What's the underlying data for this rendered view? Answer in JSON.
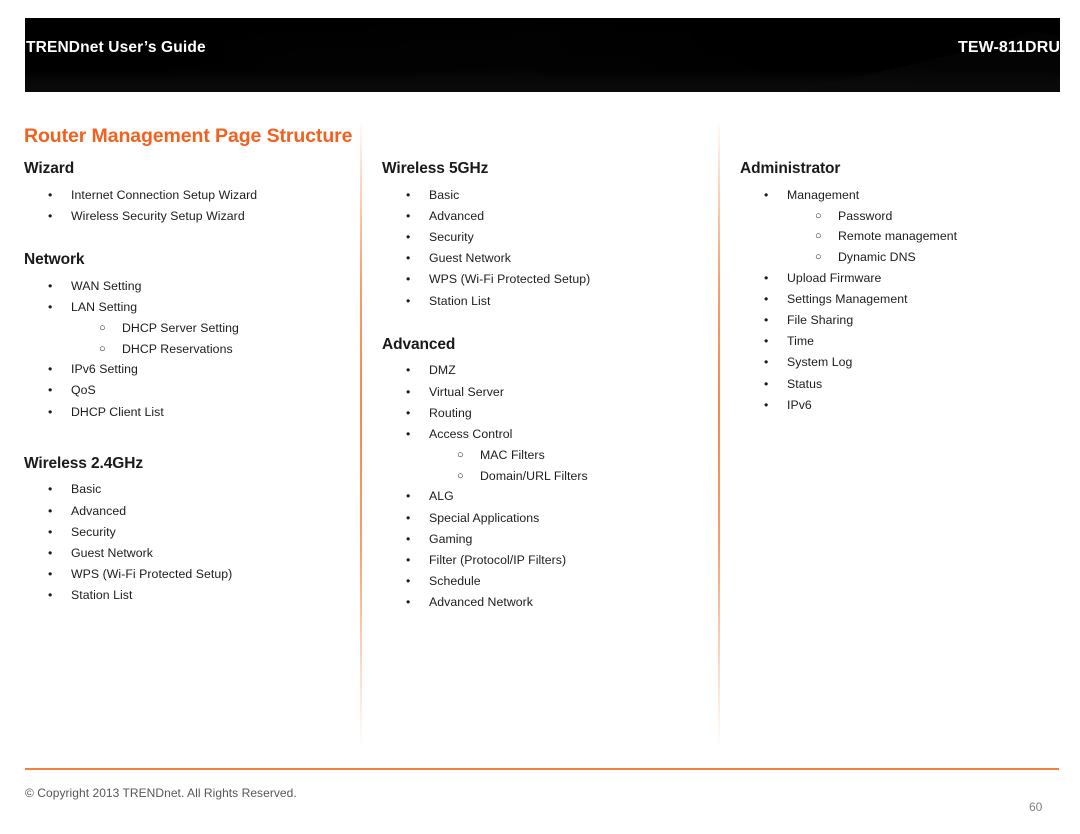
{
  "header": {
    "guide_title": "TRENDnet User’s Guide",
    "model": "TEW-811DRU"
  },
  "page_title": "Router Management Page Structure",
  "colors": {
    "accent_orange": "#F4601E",
    "footer_rule_orange": "#F4803C",
    "divider_orange": "#F47832",
    "heading_black": "#1a1a1a",
    "banner_black": "#000000"
  },
  "bullets": {
    "level1_glyph": "•",
    "level2_glyph": "○"
  },
  "columns": [
    {
      "id": "column-1",
      "sections": [
        {
          "heading": "Wizard",
          "items": [
            {
              "label": "Internet Connection Setup Wizard"
            },
            {
              "label": "Wireless Security Setup Wizard"
            }
          ]
        },
        {
          "heading": "Network",
          "items": [
            {
              "label": "WAN Setting"
            },
            {
              "label": "LAN Setting",
              "children": [
                {
                  "label": "DHCP Server Setting"
                },
                {
                  "label": "DHCP Reservations"
                }
              ]
            },
            {
              "label": "IPv6 Setting"
            },
            {
              "label": "QoS"
            },
            {
              "label": "DHCP Client List"
            }
          ]
        },
        {
          "heading": "Wireless 2.4GHz",
          "items": [
            {
              "label": "Basic"
            },
            {
              "label": "Advanced"
            },
            {
              "label": "Security"
            },
            {
              "label": "Guest Network"
            },
            {
              "label": "WPS (Wi-Fi Protected Setup)"
            },
            {
              "label": "Station List"
            }
          ]
        }
      ]
    },
    {
      "id": "column-2",
      "sections": [
        {
          "heading": "Wireless 5GHz",
          "items": [
            {
              "label": "Basic"
            },
            {
              "label": "Advanced"
            },
            {
              "label": "Security"
            },
            {
              "label": "Guest Network"
            },
            {
              "label": "WPS (Wi-Fi Protected Setup)"
            },
            {
              "label": "Station List"
            }
          ]
        },
        {
          "heading": "Advanced",
          "items": [
            {
              "label": "DMZ"
            },
            {
              "label": "Virtual Server"
            },
            {
              "label": "Routing"
            },
            {
              "label": "Access Control",
              "children": [
                {
                  "label": "MAC Filters"
                },
                {
                  "label": "Domain/URL Filters"
                }
              ]
            },
            {
              "label": "ALG"
            },
            {
              "label": "Special Applications"
            },
            {
              "label": "Gaming"
            },
            {
              "label": "Filter (Protocol/IP Filters)"
            },
            {
              "label": "Schedule"
            },
            {
              "label": "Advanced Network"
            }
          ]
        }
      ]
    },
    {
      "id": "column-3",
      "sections": [
        {
          "heading": "Administrator",
          "items": [
            {
              "label": "Management",
              "children": [
                {
                  "label": "Password"
                },
                {
                  "label": "Remote management"
                },
                {
                  "label": "Dynamic DNS"
                }
              ]
            },
            {
              "label": "Upload Firmware"
            },
            {
              "label": "Settings Management"
            },
            {
              "label": "File Sharing"
            },
            {
              "label": "Time"
            },
            {
              "label": "System Log"
            },
            {
              "label": "Status"
            },
            {
              "label": "IPv6"
            }
          ]
        }
      ]
    }
  ],
  "footer": {
    "copyright": "© Copyright 2013 TRENDnet. All Rights Reserved.",
    "page_number": "60"
  }
}
